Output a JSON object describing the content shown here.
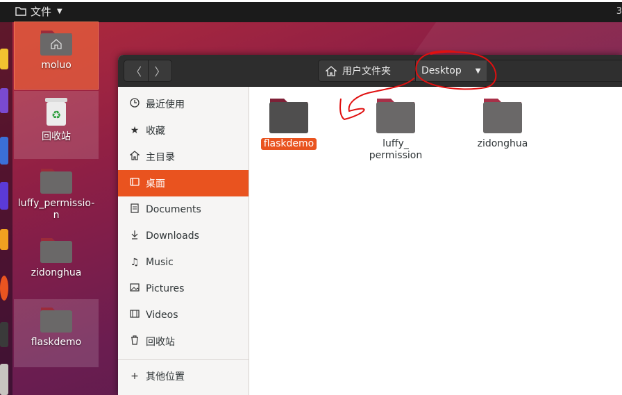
{
  "top_panel": {
    "app_menu_label": "文件",
    "edge_text": "3"
  },
  "desktop": {
    "icons": [
      {
        "label": "moluo"
      },
      {
        "label": "回收站"
      },
      {
        "label": "luffy_permission"
      },
      {
        "label": "zidonghua"
      },
      {
        "label": "flaskdemo"
      }
    ]
  },
  "window": {
    "path": {
      "home_label": "用户文件夹",
      "current_label": "Desktop"
    },
    "sidebar": {
      "items": [
        {
          "label": "最近使用",
          "icon": "clock-icon"
        },
        {
          "label": "收藏",
          "icon": "star-icon"
        },
        {
          "label": "主目录",
          "icon": "home-icon"
        },
        {
          "label": "桌面",
          "icon": "desktop-icon"
        },
        {
          "label": "Documents",
          "icon": "document-icon"
        },
        {
          "label": "Downloads",
          "icon": "download-icon"
        },
        {
          "label": "Music",
          "icon": "music-icon"
        },
        {
          "label": "Pictures",
          "icon": "picture-icon"
        },
        {
          "label": "Videos",
          "icon": "video-icon"
        },
        {
          "label": "回收站",
          "icon": "trash-icon"
        },
        {
          "label": "其他位置",
          "icon": "plus-icon"
        }
      ]
    },
    "files": [
      {
        "label": "flaskdemo"
      },
      {
        "label": "luffy_\npermission"
      },
      {
        "label": "zidonghua"
      }
    ]
  },
  "colors": {
    "accent": "#e9531f",
    "annotation": "#e01010",
    "folder_dark": "#5b5a5a",
    "folder_tab": "#9b2b3a"
  }
}
